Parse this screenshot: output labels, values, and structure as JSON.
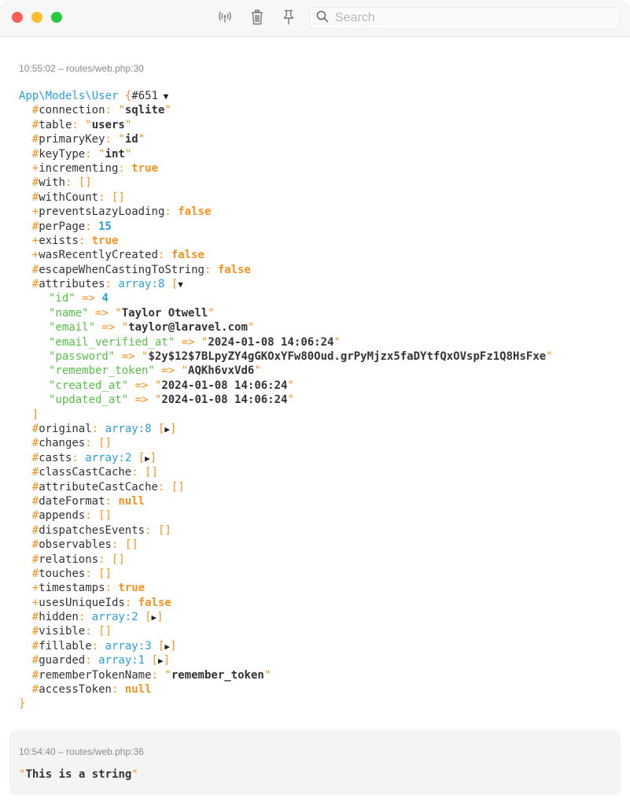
{
  "toolbar": {
    "icons": [
      "broadcast-icon",
      "trash-icon",
      "pin-icon",
      "search-icon"
    ],
    "search_placeholder": "Search",
    "search_value": ""
  },
  "entries": [
    {
      "meta": "10:55:02 – routes/web.php:30",
      "class_name": "App\\Models\\User",
      "object_id": "#651",
      "properties": [
        {
          "sigil": "#",
          "name": "connection",
          "type": "string",
          "value": "sqlite"
        },
        {
          "sigil": "#",
          "name": "table",
          "type": "string",
          "value": "users"
        },
        {
          "sigil": "#",
          "name": "primaryKey",
          "type": "string",
          "value": "id"
        },
        {
          "sigil": "#",
          "name": "keyType",
          "type": "string",
          "value": "int"
        },
        {
          "sigil": "+",
          "name": "incrementing",
          "type": "keyword",
          "value": "true"
        },
        {
          "sigil": "#",
          "name": "with",
          "type": "empty",
          "value": "[]"
        },
        {
          "sigil": "#",
          "name": "withCount",
          "type": "empty",
          "value": "[]"
        },
        {
          "sigil": "+",
          "name": "preventsLazyLoading",
          "type": "keyword",
          "value": "false"
        },
        {
          "sigil": "#",
          "name": "perPage",
          "type": "number",
          "value": "15"
        },
        {
          "sigil": "+",
          "name": "exists",
          "type": "keyword",
          "value": "true"
        },
        {
          "sigil": "+",
          "name": "wasRecentlyCreated",
          "type": "keyword",
          "value": "false"
        },
        {
          "sigil": "#",
          "name": "escapeWhenCastingToString",
          "type": "keyword",
          "value": "false"
        },
        {
          "sigil": "#",
          "name": "attributes",
          "type": "array-open",
          "value": "array:8",
          "items": [
            {
              "key": "id",
              "type": "number",
              "value": "4"
            },
            {
              "key": "name",
              "type": "string",
              "value": "Taylor Otwell"
            },
            {
              "key": "email",
              "type": "string",
              "value": "taylor@laravel.com"
            },
            {
              "key": "email_verified_at",
              "type": "string",
              "value": "2024-01-08 14:06:24"
            },
            {
              "key": "password",
              "type": "string",
              "value": "$2y$12$7BLpyZY4gGKOxYFw80Oud.grPyMjzx5faDYtfQxOVspFz1Q8HsFxe"
            },
            {
              "key": "remember_token",
              "type": "string",
              "value": "AQKh6vxVd6"
            },
            {
              "key": "created_at",
              "type": "string",
              "value": "2024-01-08 14:06:24"
            },
            {
              "key": "updated_at",
              "type": "string",
              "value": "2024-01-08 14:06:24"
            }
          ]
        },
        {
          "sigil": "#",
          "name": "original",
          "type": "array-closed",
          "value": "array:8"
        },
        {
          "sigil": "#",
          "name": "changes",
          "type": "empty",
          "value": "[]"
        },
        {
          "sigil": "#",
          "name": "casts",
          "type": "array-closed",
          "value": "array:2"
        },
        {
          "sigil": "#",
          "name": "classCastCache",
          "type": "empty",
          "value": "[]"
        },
        {
          "sigil": "#",
          "name": "attributeCastCache",
          "type": "empty",
          "value": "[]"
        },
        {
          "sigil": "#",
          "name": "dateFormat",
          "type": "keyword",
          "value": "null"
        },
        {
          "sigil": "#",
          "name": "appends",
          "type": "empty",
          "value": "[]"
        },
        {
          "sigil": "#",
          "name": "dispatchesEvents",
          "type": "empty",
          "value": "[]"
        },
        {
          "sigil": "#",
          "name": "observables",
          "type": "empty",
          "value": "[]"
        },
        {
          "sigil": "#",
          "name": "relations",
          "type": "empty",
          "value": "[]"
        },
        {
          "sigil": "#",
          "name": "touches",
          "type": "empty",
          "value": "[]"
        },
        {
          "sigil": "+",
          "name": "timestamps",
          "type": "keyword",
          "value": "true"
        },
        {
          "sigil": "+",
          "name": "usesUniqueIds",
          "type": "keyword",
          "value": "false"
        },
        {
          "sigil": "#",
          "name": "hidden",
          "type": "array-closed",
          "value": "array:2"
        },
        {
          "sigil": "#",
          "name": "visible",
          "type": "empty",
          "value": "[]"
        },
        {
          "sigil": "#",
          "name": "fillable",
          "type": "array-closed",
          "value": "array:3"
        },
        {
          "sigil": "#",
          "name": "guarded",
          "type": "array-closed",
          "value": "array:1"
        },
        {
          "sigil": "#",
          "name": "rememberTokenName",
          "type": "string",
          "value": "remember_token"
        },
        {
          "sigil": "#",
          "name": "accessToken",
          "type": "keyword",
          "value": "null"
        }
      ]
    },
    {
      "meta": "10:54:40 – routes/web.php:36",
      "string_value": "This is a string"
    }
  ]
}
